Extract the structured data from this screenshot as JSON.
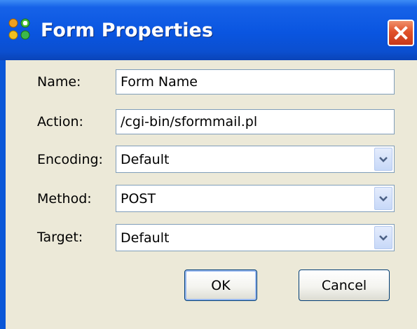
{
  "dialog": {
    "title": "Form Properties",
    "icons": {
      "app": "form-properties-icon",
      "close": "close-icon",
      "dropdown": "chevron-down-icon"
    }
  },
  "fields": {
    "name": {
      "label": "Name:",
      "value": "Form Name"
    },
    "action": {
      "label": "Action:",
      "value": "/cgi-bin/sformmail.pl"
    },
    "encoding": {
      "label": "Encoding:",
      "value": "Default"
    },
    "method": {
      "label": "Method:",
      "value": "POST"
    },
    "target": {
      "label": "Target:",
      "value": "Default"
    }
  },
  "buttons": {
    "ok": "OK",
    "cancel": "Cancel"
  },
  "colors": {
    "titlebar": "#0a55e0",
    "dialog_bg": "#ece9d8",
    "close": "#e0522a",
    "input_border": "#7f9db9"
  }
}
